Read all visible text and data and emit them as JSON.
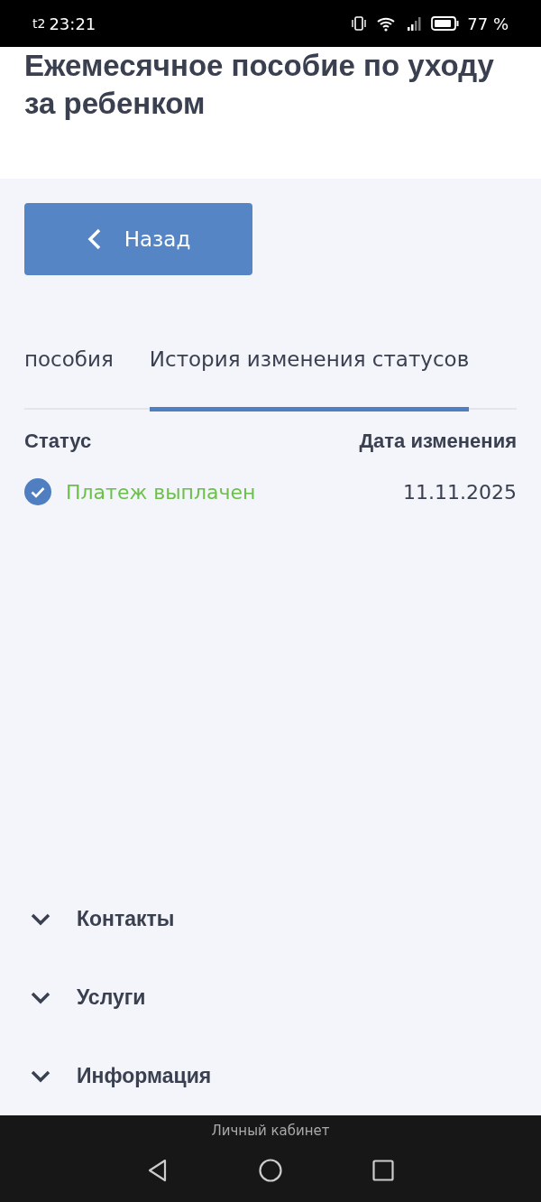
{
  "status_bar": {
    "carrier": "t2",
    "time": "23:21",
    "battery": "77 %"
  },
  "title": "Ежемесячное пособие по уходу за ребенком",
  "back_button": {
    "label": "Назад"
  },
  "tabs": [
    {
      "label": "пособия",
      "selected": false
    },
    {
      "label": "История изменения статусов",
      "selected": true
    }
  ],
  "table": {
    "columns": [
      "Статус",
      "Дата изменения"
    ],
    "rows": [
      {
        "status": "Платеж выплачен",
        "done": true,
        "date": "11.11.2025"
      }
    ]
  },
  "accordions": [
    {
      "label": "Контакты",
      "expanded": false
    },
    {
      "label": "Услуги",
      "expanded": false
    },
    {
      "label": "Информация",
      "expanded": false
    }
  ],
  "nav_bar": {
    "app_label": "Личный кабинет"
  }
}
